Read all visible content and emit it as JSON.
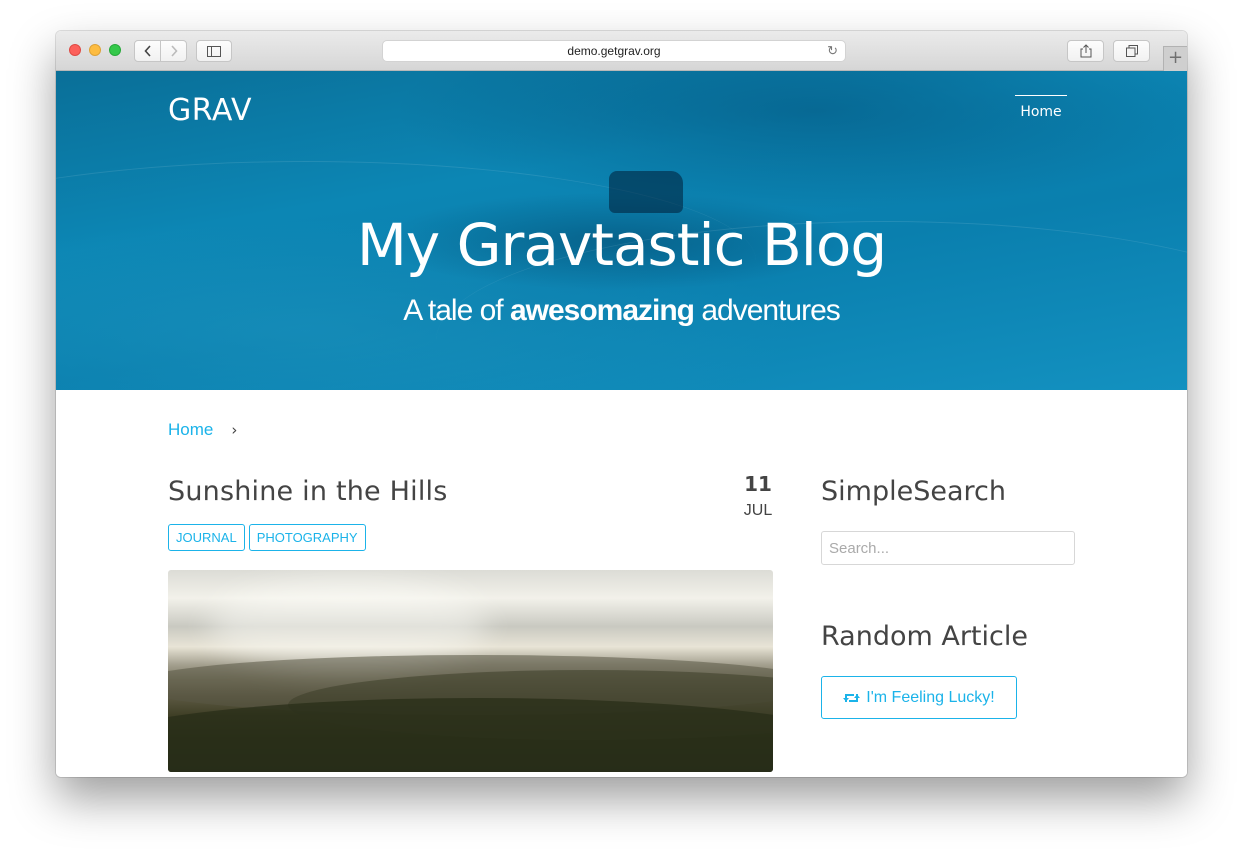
{
  "browser": {
    "url": "demo.getgrav.org"
  },
  "site": {
    "logo": "GRAV",
    "nav": [
      {
        "label": "Home"
      }
    ]
  },
  "hero": {
    "title": "My Gravtastic Blog",
    "subtitle_pre": "A tale of ",
    "subtitle_bold": "awesomazing",
    "subtitle_post": " adventures"
  },
  "breadcrumb": {
    "items": [
      {
        "label": "Home"
      }
    ],
    "separator": "›"
  },
  "post": {
    "title": "Sunshine in the Hills",
    "date_day": "11",
    "date_month": "JUL",
    "tags": [
      {
        "label": "JOURNAL"
      },
      {
        "label": "PHOTOGRAPHY"
      }
    ]
  },
  "sidebar": {
    "search_title": "SimpleSearch",
    "search_placeholder": "Search...",
    "random_title": "Random Article",
    "lucky_label": "I'm Feeling Lucky!"
  },
  "colors": {
    "accent": "#1bb3e9",
    "hero": "#0c86b4",
    "text": "#444444"
  },
  "icons": [
    "back-icon",
    "forward-icon",
    "sidebar-icon",
    "reload-icon",
    "share-icon",
    "tabs-icon",
    "plus-icon",
    "retweet-icon",
    "chevron-right-icon"
  ]
}
